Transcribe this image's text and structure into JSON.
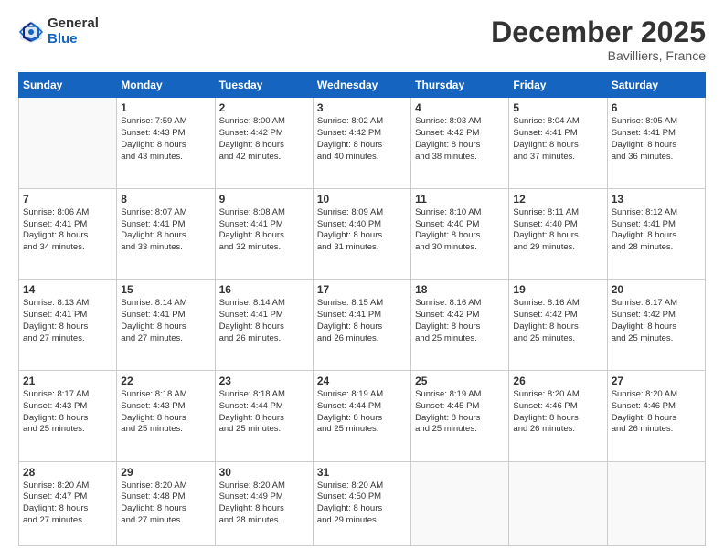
{
  "logo": {
    "general": "General",
    "blue": "Blue"
  },
  "header": {
    "month": "December 2025",
    "location": "Bavilliers, France"
  },
  "weekdays": [
    "Sunday",
    "Monday",
    "Tuesday",
    "Wednesday",
    "Thursday",
    "Friday",
    "Saturday"
  ],
  "weeks": [
    [
      {
        "day": "",
        "sunrise": "",
        "sunset": "",
        "daylight": ""
      },
      {
        "day": "1",
        "sunrise": "Sunrise: 7:59 AM",
        "sunset": "Sunset: 4:43 PM",
        "daylight": "Daylight: 8 hours and 43 minutes."
      },
      {
        "day": "2",
        "sunrise": "Sunrise: 8:00 AM",
        "sunset": "Sunset: 4:42 PM",
        "daylight": "Daylight: 8 hours and 42 minutes."
      },
      {
        "day": "3",
        "sunrise": "Sunrise: 8:02 AM",
        "sunset": "Sunset: 4:42 PM",
        "daylight": "Daylight: 8 hours and 40 minutes."
      },
      {
        "day": "4",
        "sunrise": "Sunrise: 8:03 AM",
        "sunset": "Sunset: 4:42 PM",
        "daylight": "Daylight: 8 hours and 38 minutes."
      },
      {
        "day": "5",
        "sunrise": "Sunrise: 8:04 AM",
        "sunset": "Sunset: 4:41 PM",
        "daylight": "Daylight: 8 hours and 37 minutes."
      },
      {
        "day": "6",
        "sunrise": "Sunrise: 8:05 AM",
        "sunset": "Sunset: 4:41 PM",
        "daylight": "Daylight: 8 hours and 36 minutes."
      }
    ],
    [
      {
        "day": "7",
        "sunrise": "Sunrise: 8:06 AM",
        "sunset": "Sunset: 4:41 PM",
        "daylight": "Daylight: 8 hours and 34 minutes."
      },
      {
        "day": "8",
        "sunrise": "Sunrise: 8:07 AM",
        "sunset": "Sunset: 4:41 PM",
        "daylight": "Daylight: 8 hours and 33 minutes."
      },
      {
        "day": "9",
        "sunrise": "Sunrise: 8:08 AM",
        "sunset": "Sunset: 4:41 PM",
        "daylight": "Daylight: 8 hours and 32 minutes."
      },
      {
        "day": "10",
        "sunrise": "Sunrise: 8:09 AM",
        "sunset": "Sunset: 4:40 PM",
        "daylight": "Daylight: 8 hours and 31 minutes."
      },
      {
        "day": "11",
        "sunrise": "Sunrise: 8:10 AM",
        "sunset": "Sunset: 4:40 PM",
        "daylight": "Daylight: 8 hours and 30 minutes."
      },
      {
        "day": "12",
        "sunrise": "Sunrise: 8:11 AM",
        "sunset": "Sunset: 4:40 PM",
        "daylight": "Daylight: 8 hours and 29 minutes."
      },
      {
        "day": "13",
        "sunrise": "Sunrise: 8:12 AM",
        "sunset": "Sunset: 4:41 PM",
        "daylight": "Daylight: 8 hours and 28 minutes."
      }
    ],
    [
      {
        "day": "14",
        "sunrise": "Sunrise: 8:13 AM",
        "sunset": "Sunset: 4:41 PM",
        "daylight": "Daylight: 8 hours and 27 minutes."
      },
      {
        "day": "15",
        "sunrise": "Sunrise: 8:14 AM",
        "sunset": "Sunset: 4:41 PM",
        "daylight": "Daylight: 8 hours and 27 minutes."
      },
      {
        "day": "16",
        "sunrise": "Sunrise: 8:14 AM",
        "sunset": "Sunset: 4:41 PM",
        "daylight": "Daylight: 8 hours and 26 minutes."
      },
      {
        "day": "17",
        "sunrise": "Sunrise: 8:15 AM",
        "sunset": "Sunset: 4:41 PM",
        "daylight": "Daylight: 8 hours and 26 minutes."
      },
      {
        "day": "18",
        "sunrise": "Sunrise: 8:16 AM",
        "sunset": "Sunset: 4:42 PM",
        "daylight": "Daylight: 8 hours and 25 minutes."
      },
      {
        "day": "19",
        "sunrise": "Sunrise: 8:16 AM",
        "sunset": "Sunset: 4:42 PM",
        "daylight": "Daylight: 8 hours and 25 minutes."
      },
      {
        "day": "20",
        "sunrise": "Sunrise: 8:17 AM",
        "sunset": "Sunset: 4:42 PM",
        "daylight": "Daylight: 8 hours and 25 minutes."
      }
    ],
    [
      {
        "day": "21",
        "sunrise": "Sunrise: 8:17 AM",
        "sunset": "Sunset: 4:43 PM",
        "daylight": "Daylight: 8 hours and 25 minutes."
      },
      {
        "day": "22",
        "sunrise": "Sunrise: 8:18 AM",
        "sunset": "Sunset: 4:43 PM",
        "daylight": "Daylight: 8 hours and 25 minutes."
      },
      {
        "day": "23",
        "sunrise": "Sunrise: 8:18 AM",
        "sunset": "Sunset: 4:44 PM",
        "daylight": "Daylight: 8 hours and 25 minutes."
      },
      {
        "day": "24",
        "sunrise": "Sunrise: 8:19 AM",
        "sunset": "Sunset: 4:44 PM",
        "daylight": "Daylight: 8 hours and 25 minutes."
      },
      {
        "day": "25",
        "sunrise": "Sunrise: 8:19 AM",
        "sunset": "Sunset: 4:45 PM",
        "daylight": "Daylight: 8 hours and 25 minutes."
      },
      {
        "day": "26",
        "sunrise": "Sunrise: 8:20 AM",
        "sunset": "Sunset: 4:46 PM",
        "daylight": "Daylight: 8 hours and 26 minutes."
      },
      {
        "day": "27",
        "sunrise": "Sunrise: 8:20 AM",
        "sunset": "Sunset: 4:46 PM",
        "daylight": "Daylight: 8 hours and 26 minutes."
      }
    ],
    [
      {
        "day": "28",
        "sunrise": "Sunrise: 8:20 AM",
        "sunset": "Sunset: 4:47 PM",
        "daylight": "Daylight: 8 hours and 27 minutes."
      },
      {
        "day": "29",
        "sunrise": "Sunrise: 8:20 AM",
        "sunset": "Sunset: 4:48 PM",
        "daylight": "Daylight: 8 hours and 27 minutes."
      },
      {
        "day": "30",
        "sunrise": "Sunrise: 8:20 AM",
        "sunset": "Sunset: 4:49 PM",
        "daylight": "Daylight: 8 hours and 28 minutes."
      },
      {
        "day": "31",
        "sunrise": "Sunrise: 8:20 AM",
        "sunset": "Sunset: 4:50 PM",
        "daylight": "Daylight: 8 hours and 29 minutes."
      },
      {
        "day": "",
        "sunrise": "",
        "sunset": "",
        "daylight": ""
      },
      {
        "day": "",
        "sunrise": "",
        "sunset": "",
        "daylight": ""
      },
      {
        "day": "",
        "sunrise": "",
        "sunset": "",
        "daylight": ""
      }
    ]
  ]
}
